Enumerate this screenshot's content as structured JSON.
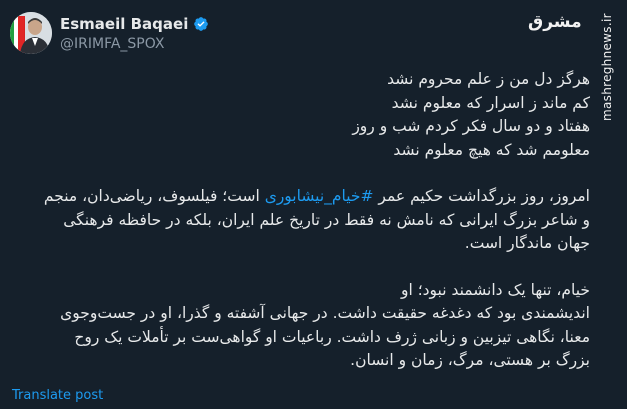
{
  "author": {
    "display_name": "Esmaeil Baqaei",
    "handle": "@IRIMFA_SPOX"
  },
  "branding": {
    "logo_text": "مشرق",
    "watermark": "mashreghnews.ir"
  },
  "post": {
    "poem": [
      "هرگز دل من ز علم محروم نشد",
      "کم ماند ز اسرار که معلوم نشد",
      "هفتاد و دو سال فکر کردم شب و روز",
      "معلومم شد که هیچ معلوم نشد"
    ],
    "p2_line1_before": "امروز، روز بزرگداشت حکیم عمر ",
    "p2_hashtag": "#خیام_نیشابوری",
    "p2_line1_after": " است؛ فیلسوف، ریاضی‌دان، منجم",
    "p2_line2": "و شاعر بزرگ ایرانی که نامش نه فقط در تاریخ علم ایران، بلکه در حافظه فرهنگی",
    "p2_line3": "جهان ماندگار است.",
    "p3_line1": "خیام، تنها یک دانشمند نبود؛ او",
    "p3_line2": "اندیشمندی بود که دغدغه حقیقت داشت. در جهانی آشفته و گذرا، او در جست‌وجوی",
    "p3_line3": "معنا، نگاهی تیزبین و زبانی ژرف داشت. رباعیات او گواهی‌ست بر تأملات یک روح",
    "p3_line4": "بزرگ بر هستی، مرگ، زمان و انسان."
  },
  "actions": {
    "translate_label": "Translate post"
  },
  "colors": {
    "background": "#15202b",
    "text": "#e7e9ea",
    "secondary": "#8b98a5",
    "link": "#1d9bf0",
    "verified": "#1d9bf0"
  },
  "icons": {
    "verified": "verified-badge-icon",
    "logo": "mashregh-logo-icon"
  }
}
